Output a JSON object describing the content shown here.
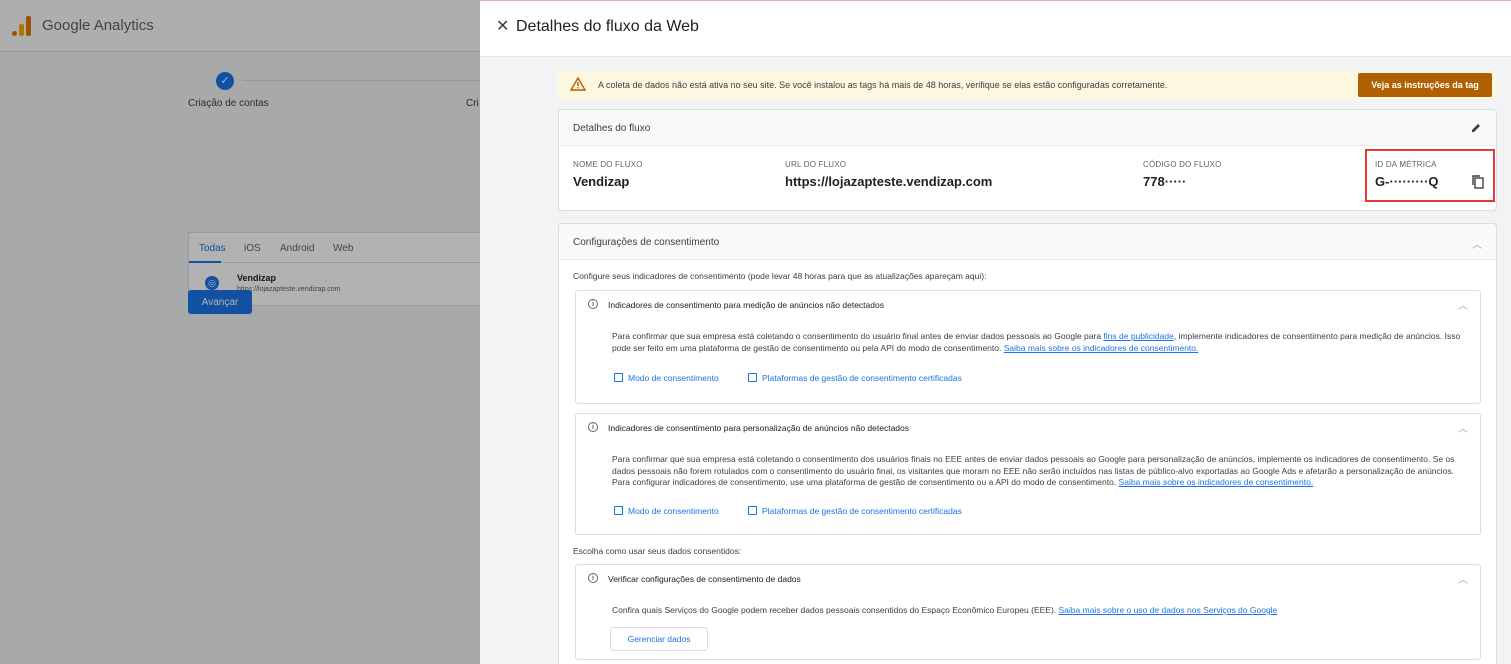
{
  "app": {
    "title": "Google Analytics"
  },
  "background": {
    "steps": [
      "Criação de contas",
      "Cri"
    ],
    "platform_tabs": [
      "Todas",
      "iOS",
      "Android",
      "Web"
    ],
    "stream": {
      "name": "Vendizap",
      "url": "https://lojazapteste.vendizap.com"
    },
    "next_button": "Avançar"
  },
  "panel": {
    "title": "Detalhes do fluxo da Web",
    "warning": {
      "text": "A coleta de dados não está ativa no seu site. Se você instalou as tags há mais de 48 horas, verifique se elas estão configuradas corretamente.",
      "button": "Veja as instruções da tag"
    },
    "details": {
      "title": "Detalhes do fluxo",
      "fields": [
        {
          "label": "NOME DO FLUXO",
          "value": "Vendizap"
        },
        {
          "label": "URL DO FLUXO",
          "value": "https://lojazapteste.vendizap.com"
        },
        {
          "label": "CÓDIGO DO FLUXO",
          "value": "778·····"
        },
        {
          "label": "ID DA MÉTRICA",
          "value": "G-·········Q"
        }
      ]
    },
    "consent": {
      "title": "Configurações de consentimento",
      "intro": "Configure seus indicadores de consentimento (pode levar 48 horas para que as atualizações apareçam aqui):",
      "ads_measurement": {
        "title": "Indicadores de consentimento para medição de anúncios não detectados",
        "body_1": "Para confirmar que sua empresa está coletando o consentimento do usuário final antes de enviar dados pessoais ao Google para ",
        "link_1": "fins de publicidade",
        "body_2": ", implemente indicadores de consentimento para medição de anúncios. Isso pode ser feito em uma plataforma de gestão de consentimento ou pela API do modo de consentimento. ",
        "link_2": "Saiba mais sobre os indicadores de consentimento.",
        "action_1": "Modo de consentimento",
        "action_2": "Plataformas de gestão de consentimento certificadas"
      },
      "ads_personalization": {
        "title": "Indicadores de consentimento para personalização de anúncios não detectados",
        "body_1": "Para confirmar que sua empresa está coletando o consentimento dos usuários finais no EEE antes de enviar dados pessoais ao Google para personalização de anúncios, implemente os indicadores de consentimento. Se os dados pessoais não forem rotulados com o consentimento do usuário final, os visitantes que moram no EEE não serão incluídos nas listas de público-alvo exportadas ao Google Ads e afetarão a personalização de anúncios. Para configurar indicadores de consentimento, use uma plataforma de gestão de consentimento ou a API do modo de consentimento. ",
        "link_1": "Saiba mais sobre os indicadores de consentimento.",
        "action_1": "Modo de consentimento",
        "action_2": "Plataformas de gestão de consentimento certificadas"
      },
      "choose": "Escolha como usar seus dados consentidos:",
      "verify": {
        "title": "Verificar configurações de consentimento de dados",
        "body_1": "Confira quais Serviços do Google podem receber dados pessoais consentidos do Espaço Econômico Europeu (EEE). ",
        "link_1": "Saiba mais sobre o uso de dados nos Serviços do Google",
        "button": "Gerenciar dados"
      }
    }
  },
  "colors": {
    "accent": "#1a73e8",
    "warning_bg": "#fef7e0",
    "warning_button": "#b06000",
    "highlight_border": "#e53935"
  }
}
